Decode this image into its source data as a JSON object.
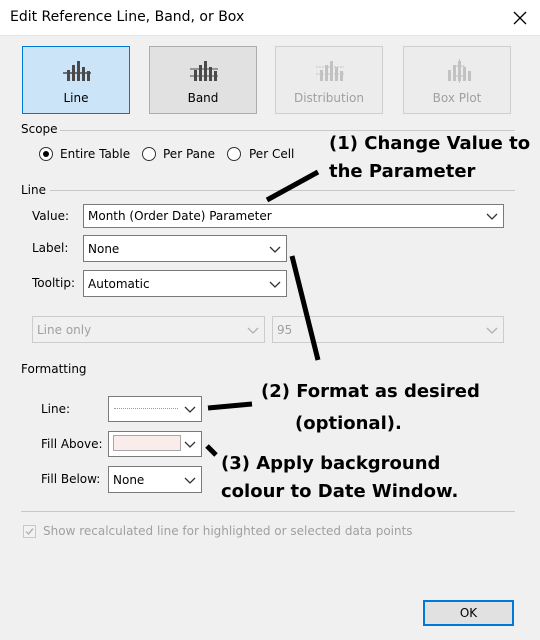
{
  "dialog": {
    "title": "Edit Reference Line, Band, or Box",
    "close_icon": "close-icon"
  },
  "types": [
    {
      "label": "Line",
      "state": "selected",
      "icon": "line-chart-icon"
    },
    {
      "label": "Band",
      "state": "normal",
      "icon": "band-chart-icon"
    },
    {
      "label": "Distribution",
      "state": "disabled",
      "icon": "distribution-chart-icon"
    },
    {
      "label": "Box Plot",
      "state": "disabled",
      "icon": "box-plot-icon"
    }
  ],
  "scope": {
    "heading": "Scope",
    "options": [
      {
        "label": "Entire Table",
        "checked": true
      },
      {
        "label": "Per Pane",
        "checked": false
      },
      {
        "label": "Per Cell",
        "checked": false
      }
    ]
  },
  "line": {
    "heading": "Line",
    "value_label": "Value:",
    "value": "Month (Order Date) Parameter",
    "label_label": "Label:",
    "label_value": "None",
    "tooltip_label": "Tooltip:",
    "tooltip_value": "Automatic",
    "line_mode": "Line only",
    "confidence": "95"
  },
  "formatting": {
    "heading": "Formatting",
    "line_label": "Line:",
    "fill_above_label": "Fill Above:",
    "fill_below_label": "Fill Below:",
    "fill_below_value": "None",
    "fill_above_color": "#fbecec"
  },
  "recalc_checkbox": {
    "label": "Show recalculated line for highlighted or selected data points",
    "checked": true,
    "disabled": true
  },
  "ok_label": "OK",
  "annotations": {
    "a1_line1": "(1) Change Value to",
    "a1_line2": "the Parameter",
    "a2_line1": "(2) Format as desired",
    "a2_line2": "(optional).",
    "a3_line1": "(3) Apply background",
    "a3_line2": "colour to Date Window."
  },
  "colors": {
    "accent": "#0078d7",
    "selected_tile": "#cce4f7",
    "dialog_bg": "#f0f0f0"
  }
}
